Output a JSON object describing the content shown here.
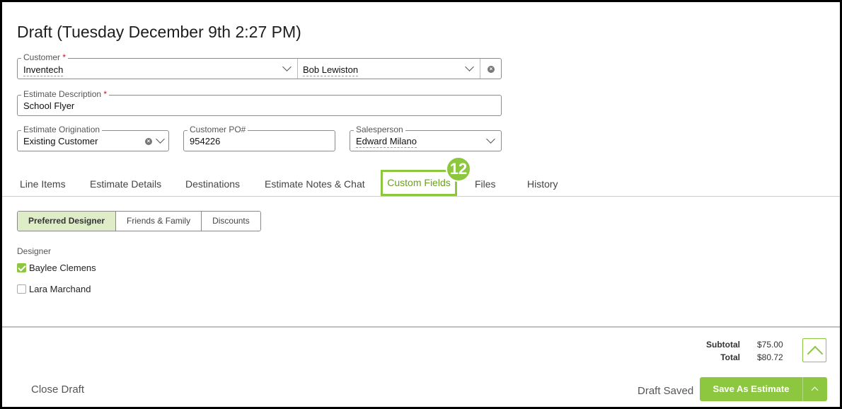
{
  "header": {
    "title": "Draft (Tuesday December 9th 2:27 PM)"
  },
  "customer": {
    "label": "Customer",
    "required": "*",
    "company": "Inventech",
    "contact": "Bob Lewiston"
  },
  "description": {
    "label": "Estimate Description",
    "required": "*",
    "value": "School Flyer"
  },
  "origination": {
    "label": "Estimate Origination",
    "value": "Existing Customer"
  },
  "po": {
    "label": "Customer PO#",
    "value": "954226"
  },
  "salesperson": {
    "label": "Salesperson",
    "value": "Edward Milano"
  },
  "tabs": {
    "line_items": "Line Items",
    "estimate_details": "Estimate Details",
    "destinations": "Destinations",
    "notes_chat": "Estimate Notes & Chat",
    "custom_fields": "Custom Fields",
    "files": "Files",
    "history": "History",
    "active": "Custom Fields"
  },
  "callout": {
    "number": "12"
  },
  "segments": {
    "preferred": "Preferred Designer",
    "friends": "Friends & Family",
    "discounts": "Discounts"
  },
  "designer": {
    "label": "Designer",
    "options": [
      {
        "name": "Baylee Clemens",
        "checked": true
      },
      {
        "name": "Lara Marchand",
        "checked": false
      }
    ]
  },
  "totals": {
    "subtotal_label": "Subtotal",
    "subtotal": "$75.00",
    "total_label": "Total",
    "total": "$80.72"
  },
  "footer": {
    "close_draft": "Close Draft",
    "draft_saved": "Draft Saved",
    "save_label": "Save As Estimate"
  },
  "colors": {
    "accent": "#8dc63f",
    "accent_text": "#6aa21c",
    "required": "#c8102e"
  },
  "icons": {
    "dropdown": "chevron-down-icon",
    "clear": "clear-circle-icon",
    "check": "check-icon",
    "scroll_top": "chevron-up-icon"
  }
}
